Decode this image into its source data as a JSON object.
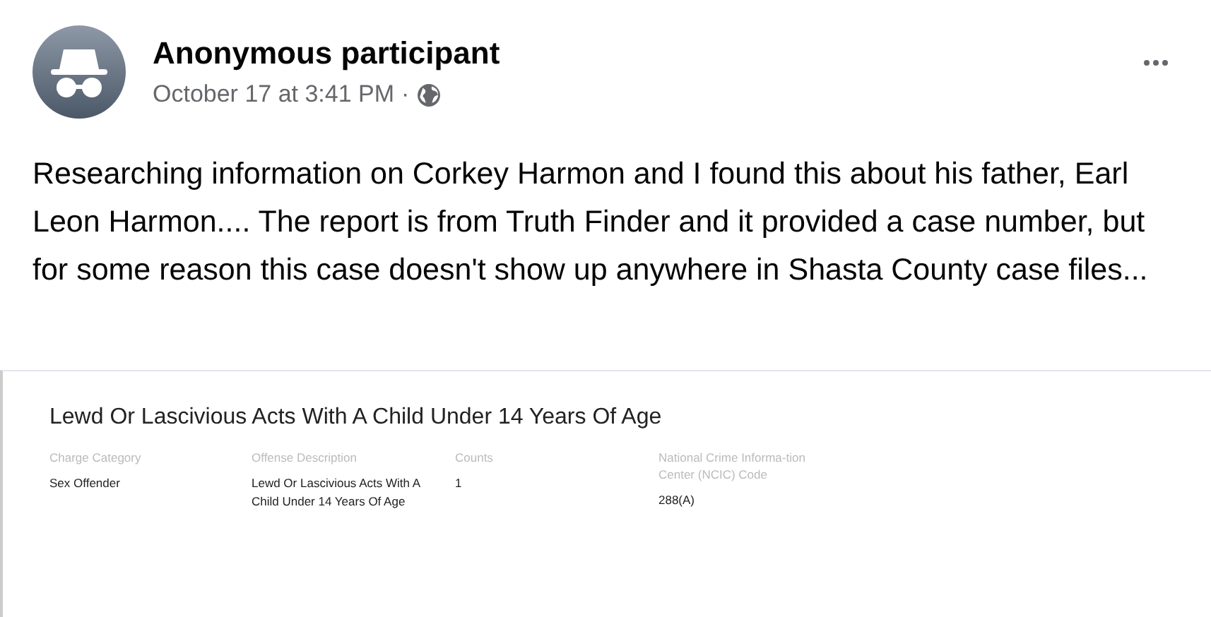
{
  "post": {
    "author": "Anonymous participant",
    "time": "October 17 at 3:41 PM",
    "separator": "·",
    "text": "Researching information on Corkey Harmon and I found this about his father, Earl Leon Harmon.... The report is from Truth Finder and it provided a case number, but for some reason this case doesn't show up anywhere in Shasta County case files..."
  },
  "document": {
    "title": "Lewd Or Lascivious Acts With A Child Under 14 Years Of Age",
    "fields": [
      {
        "label": "Charge Category",
        "value": "Sex Offender"
      },
      {
        "label": "Offense Description",
        "value": "Lewd Or Lascivious Acts With A Child Under 14 Years Of Age"
      },
      {
        "label": "Counts",
        "value": "1"
      },
      {
        "label": "National Crime Informa-tion Center (NCIC) Code",
        "value": "288(A)"
      }
    ]
  }
}
